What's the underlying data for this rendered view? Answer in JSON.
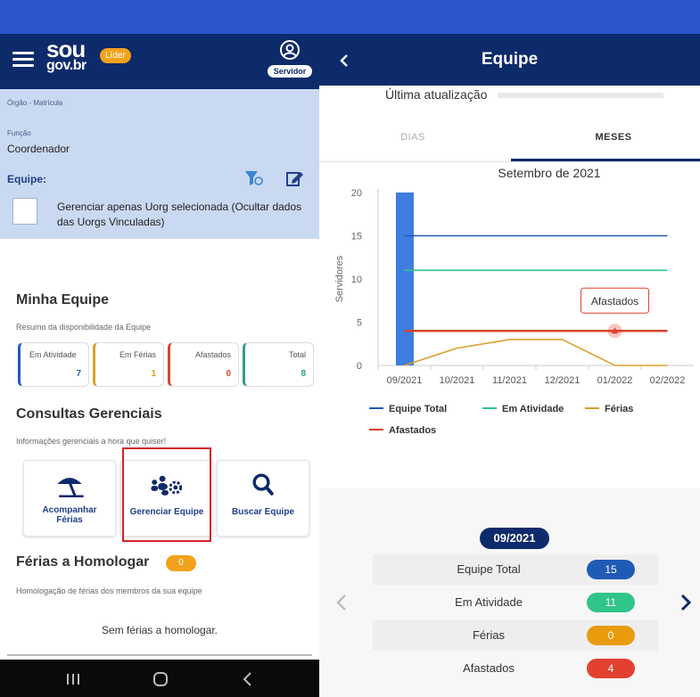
{
  "left": {
    "logo": {
      "sou": "sou",
      "gov": "gov.br",
      "badge": "Líder"
    },
    "profile": {
      "label": "Servidor"
    },
    "org": {
      "orgao_label": "Órgão - Matrícula",
      "funcao_label": "Função",
      "funcao_value": "Coordenador",
      "equipe_label": "Equipe:",
      "checkbox_text_1": "Gerenciar apenas Uorg selecionada (Ocultar dados",
      "checkbox_text_2": "das Uorgs Vinculadas)"
    },
    "minha_equipe": {
      "title": "Minha Equipe",
      "subtitle": "Resumo da disponibilidade da Equipe",
      "cards": [
        {
          "label": "Em Atividade",
          "value": "7",
          "color": "#1f5bb5"
        },
        {
          "label": "Em Férias",
          "value": "1",
          "color": "#e0a01e"
        },
        {
          "label": "Afastados",
          "value": "0",
          "color": "#d8432e"
        },
        {
          "label": "Total",
          "value": "8",
          "color": "#2e9f8a"
        }
      ]
    },
    "consultas": {
      "title": "Consultas Gerenciais",
      "subtitle": "Informações gerenciais a hora que quiser!",
      "items": [
        {
          "label1": "Acompanhar",
          "label2": "Férias",
          "icon": "beach-umbrella-icon"
        },
        {
          "label1": "Gerenciar Equipe",
          "label2": "",
          "icon": "team-gear-icon"
        },
        {
          "label1": "Buscar Equipe",
          "label2": "",
          "icon": "search-icon"
        }
      ]
    },
    "ferias": {
      "title": "Férias a Homologar",
      "badge": "0",
      "subtitle": "Homologação de férias dos membros da sua equipe",
      "empty": "Sem férias a homologar."
    }
  },
  "right": {
    "title": "Equipe",
    "last_update": "Última atualização",
    "tabs": [
      "DIAS",
      "MESES"
    ],
    "selected_tab": "MESES",
    "detail": {
      "period": "09/2021",
      "rows": [
        {
          "label": "Equipe Total",
          "value": "15",
          "color": "#1f5bb5"
        },
        {
          "label": "Em Atividade",
          "value": "11",
          "color": "#2ec48a"
        },
        {
          "label": "Férias",
          "value": "0",
          "color": "#e89b0c"
        },
        {
          "label": "Afastados",
          "value": "4",
          "color": "#e3412f"
        }
      ]
    }
  },
  "chart_data": {
    "type": "line",
    "title": "Setembro de 2021",
    "ylabel": "Servidores",
    "xlabel": "",
    "ylim": [
      0,
      20
    ],
    "yticks": [
      "0",
      "5",
      "10",
      "15",
      "20"
    ],
    "categories": [
      "09/2021",
      "10/2021",
      "11/2021",
      "12/2021",
      "01/2022",
      "02/2022"
    ],
    "series": [
      {
        "name": "Equipe Total",
        "color": "#1f5bb5",
        "values": [
          15,
          15,
          15,
          15,
          15,
          15
        ]
      },
      {
        "name": "Em Atividade",
        "color": "#2ec48a",
        "values": [
          11,
          11,
          11,
          11,
          11,
          11
        ]
      },
      {
        "name": "Férias",
        "color": "#d9a030",
        "values": [
          0,
          2,
          3,
          3,
          0,
          0
        ]
      },
      {
        "name": "Afastados",
        "color": "#d8432e",
        "values": [
          4,
          4,
          4,
          4,
          4,
          4
        ]
      }
    ],
    "highlight_category": "09/2021",
    "tooltip": "Afastados",
    "legend_position": "bottom"
  }
}
